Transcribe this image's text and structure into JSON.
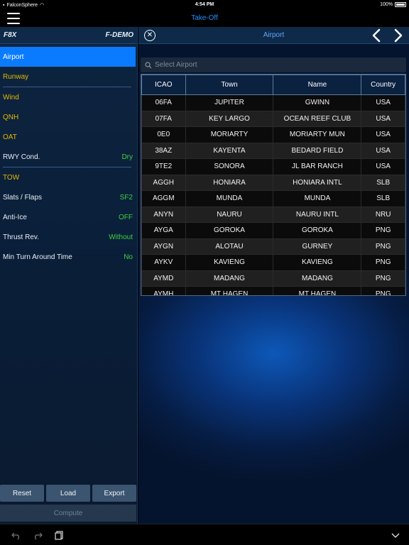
{
  "status_bar": {
    "carrier": "FalconSphere",
    "time": "4:54 PM",
    "battery": "100%"
  },
  "nav": {
    "title": "Take-Off"
  },
  "left": {
    "aircraft": "F8X",
    "profile": "F-DEMO",
    "items": [
      {
        "label": "Airport",
        "value": ""
      },
      {
        "label": "Runway",
        "value": ""
      },
      {
        "label": "Wind",
        "value": ""
      },
      {
        "label": "QNH",
        "value": ""
      },
      {
        "label": "OAT",
        "value": ""
      },
      {
        "label": "RWY Cond.",
        "value": "Dry"
      },
      {
        "label": "TOW",
        "value": ""
      },
      {
        "label": "Slats / Flaps",
        "value": "SF2"
      },
      {
        "label": "Anti-Ice",
        "value": "OFF"
      },
      {
        "label": "Thrust Rev.",
        "value": "Without"
      },
      {
        "label": "Min Turn Around Time",
        "value": "No"
      }
    ],
    "buttons": {
      "reset": "Reset",
      "load": "Load",
      "export": "Export",
      "compute": "Compute"
    }
  },
  "right": {
    "title": "Airport",
    "search_placeholder": "Select Airport",
    "columns": [
      "ICAO",
      "Town",
      "Name",
      "Country"
    ],
    "rows": [
      [
        "06FA",
        "JUPITER",
        "GWINN",
        "USA"
      ],
      [
        "07FA",
        "KEY LARGO",
        "OCEAN REEF CLUB",
        "USA"
      ],
      [
        "0E0",
        "MORIARTY",
        "MORIARTY MUN",
        "USA"
      ],
      [
        "38AZ",
        "KAYENTA",
        "BEDARD FIELD",
        "USA"
      ],
      [
        "9TE2",
        "SONORA",
        "JL BAR RANCH",
        "USA"
      ],
      [
        "AGGH",
        "HONIARA",
        "HONIARA INTL",
        "SLB"
      ],
      [
        "AGGM",
        "MUNDA",
        "MUNDA",
        "SLB"
      ],
      [
        "ANYN",
        "NAURU",
        "NAURU INTL",
        "NRU"
      ],
      [
        "AYGA",
        "GOROKA",
        "GOROKA",
        "PNG"
      ],
      [
        "AYGN",
        "ALOTAU",
        "GURNEY",
        "PNG"
      ],
      [
        "AYKV",
        "KAVIENG",
        "KAVIENG",
        "PNG"
      ],
      [
        "AYMD",
        "MADANG",
        "MADANG",
        "PNG"
      ],
      [
        "AYMH",
        "MT HAGEN",
        "MT HAGEN",
        "PNG"
      ]
    ]
  },
  "colors": {
    "accent": "#0a7bff",
    "label_yellow": "#e6b800",
    "value_green": "#3ed13e"
  }
}
